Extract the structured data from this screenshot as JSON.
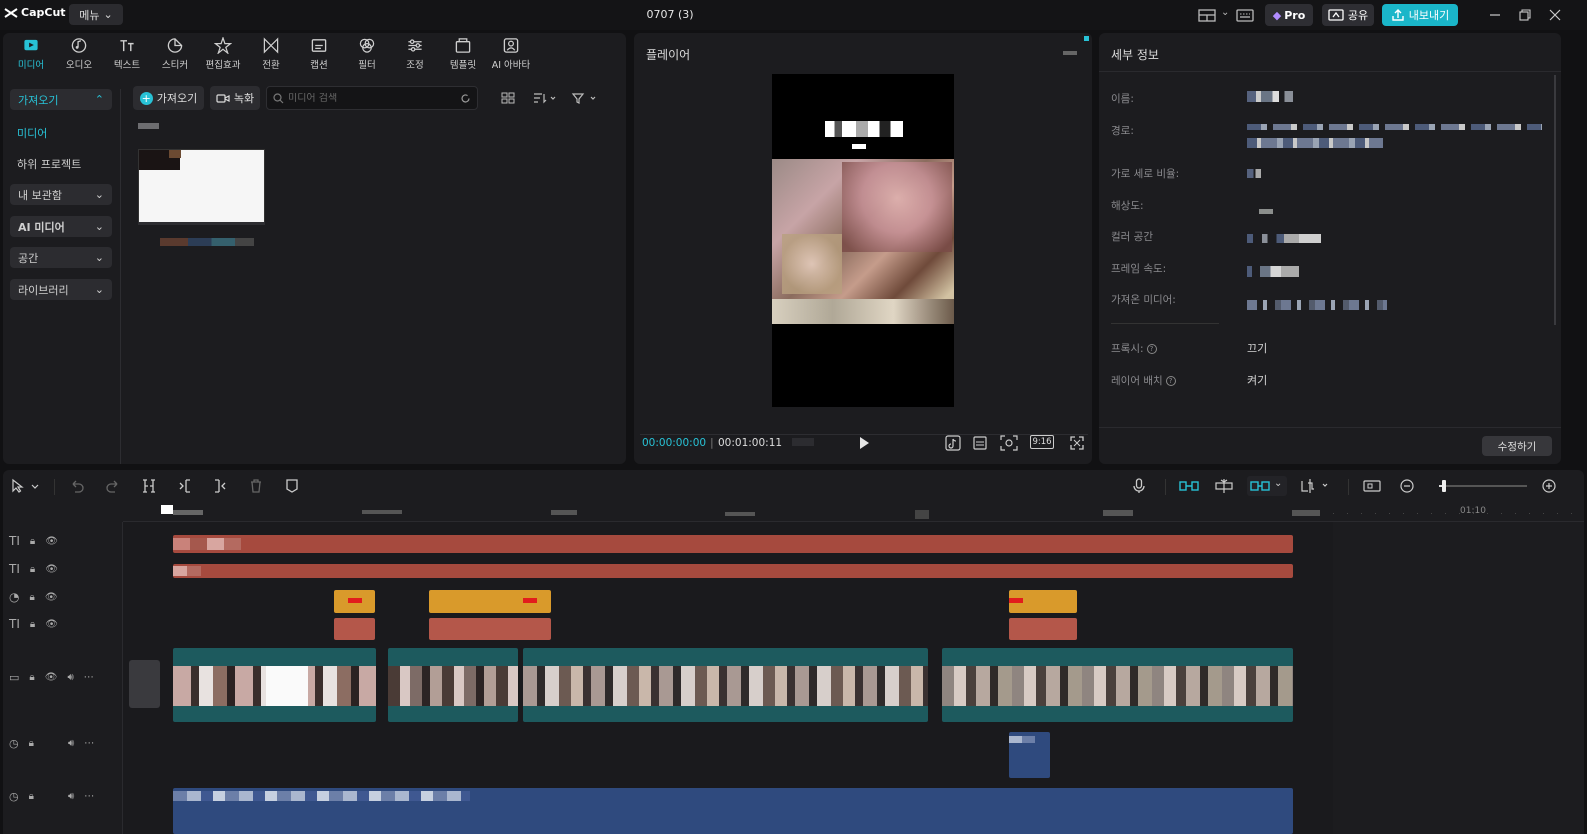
{
  "app": {
    "name": "CapCut",
    "menu_label": "메뉴",
    "project_title": "0707 (3)"
  },
  "titlebar": {
    "pro_label": "Pro",
    "share_label": "공유",
    "export_label": "내보내기"
  },
  "tools": [
    {
      "label": "미디어",
      "icon": "media-icon",
      "active": true
    },
    {
      "label": "오디오",
      "icon": "audio-icon"
    },
    {
      "label": "텍스트",
      "icon": "text-icon"
    },
    {
      "label": "스티커",
      "icon": "sticker-icon"
    },
    {
      "label": "편집효과",
      "icon": "effects-icon"
    },
    {
      "label": "전환",
      "icon": "transition-icon"
    },
    {
      "label": "캡션",
      "icon": "caption-icon"
    },
    {
      "label": "필터",
      "icon": "filter-icon"
    },
    {
      "label": "조정",
      "icon": "adjust-icon"
    },
    {
      "label": "템플릿",
      "icon": "template-icon"
    },
    {
      "label": "AI 아바타",
      "icon": "ai-avatar-icon"
    }
  ],
  "sidebar": {
    "import_group": "가져오기",
    "media": "미디어",
    "sub_project": "하위 프로젝트",
    "my_library": "내 보관함",
    "ai_media": "AI 미디어",
    "space": "공간",
    "library": "라이브러리"
  },
  "media_toolbar": {
    "import_label": "가져오기",
    "record_label": "녹화",
    "search_placeholder": "미디어 검색"
  },
  "player": {
    "title": "플레이어",
    "current_time": "00:00:00:00",
    "separator": "|",
    "duration": "00:01:00:11",
    "ratio": "9:16"
  },
  "details": {
    "title": "세부 정보",
    "labels": {
      "name": "이름:",
      "path": "경로:",
      "aspect": "가로 세로 비율:",
      "resolution": "해상도:",
      "color_space": "컬러 공간",
      "frame_rate": "프레임 속도:",
      "imported": "가져온 미디어:",
      "proxy": "프록시:",
      "layer": "레이어 배치"
    },
    "proxy_value": "끄기",
    "layer_value": "켜기",
    "edit_label": "수정하기"
  },
  "timeline": {
    "ruler_label": "01:10"
  },
  "colors": {
    "accent": "#28c2d6",
    "text_clip": "#a64a3e",
    "sticker_clip": "#d99a2b",
    "audio_clip": "#2f4a7e",
    "video_clip": "#1d5a5e"
  }
}
